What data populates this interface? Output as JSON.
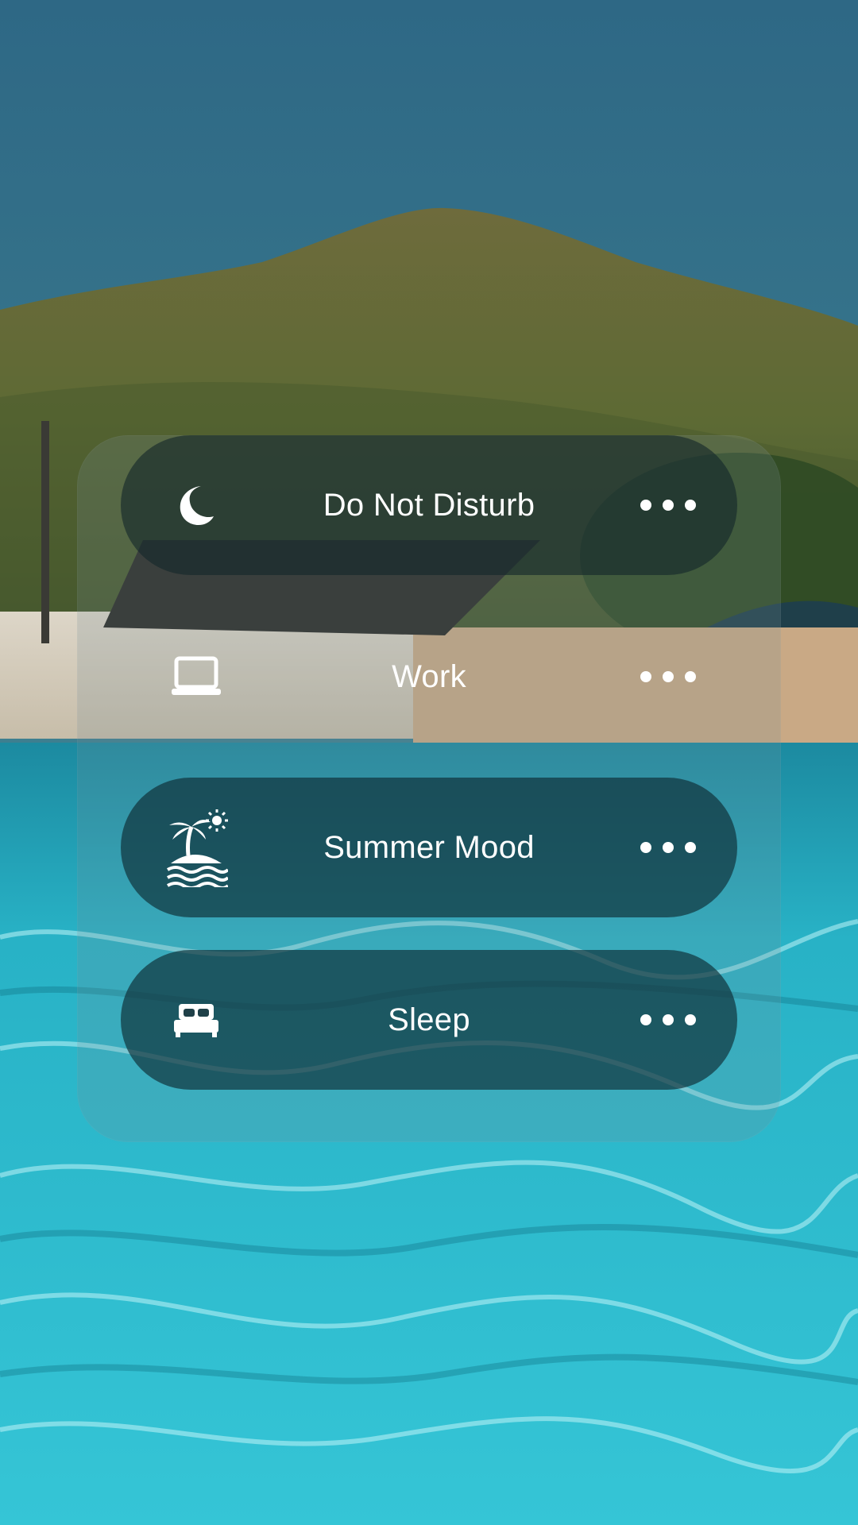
{
  "focus_modes": [
    {
      "label": "Do Not Disturb",
      "icon": "moon-icon",
      "state": "active"
    },
    {
      "label": "Work",
      "icon": "laptop-icon",
      "state": "inactive"
    },
    {
      "label": "Summer Mood",
      "icon": "island-icon",
      "state": "inactive"
    },
    {
      "label": "Sleep",
      "icon": "bed-icon",
      "state": "inactive"
    }
  ],
  "colors": {
    "water": "#2fb8c9",
    "sky": "#2f6e86",
    "hill": "#6b6a3a"
  }
}
